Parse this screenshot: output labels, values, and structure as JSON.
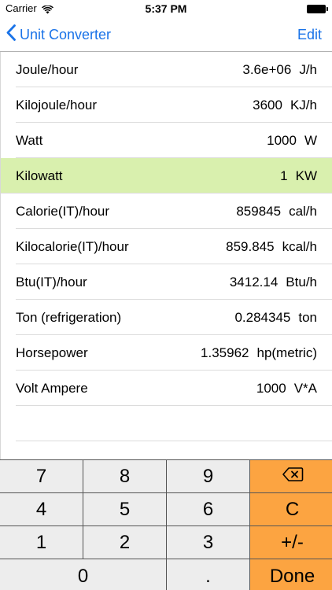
{
  "status_bar": {
    "carrier": "Carrier",
    "time": "5:37 PM"
  },
  "nav": {
    "back_label": "Unit Converter",
    "edit_label": "Edit"
  },
  "units": [
    {
      "name": "Joule/hour",
      "value": "3.6e+06",
      "symbol": "J/h"
    },
    {
      "name": "Kilojoule/hour",
      "value": "3600",
      "symbol": "KJ/h"
    },
    {
      "name": "Watt",
      "value": "1000",
      "symbol": "W"
    },
    {
      "name": "Kilowatt",
      "value": "1",
      "symbol": "KW",
      "selected": true
    },
    {
      "name": "Calorie(IT)/hour",
      "value": "859845",
      "symbol": "cal/h"
    },
    {
      "name": "Kilocalorie(IT)/hour",
      "value": "859.845",
      "symbol": "kcal/h"
    },
    {
      "name": "Btu(IT)/hour",
      "value": "3412.14",
      "symbol": "Btu/h"
    },
    {
      "name": "Ton (refrigeration)",
      "value": "0.284345",
      "symbol": "ton"
    },
    {
      "name": "Horsepower",
      "value": "1.35962",
      "symbol": "hp(metric)"
    },
    {
      "name": "Volt Ampere",
      "value": "1000",
      "symbol": "V*A"
    }
  ],
  "keypad": {
    "k7": "7",
    "k8": "8",
    "k9": "9",
    "k4": "4",
    "k5": "5",
    "k6": "6",
    "k1": "1",
    "k2": "2",
    "k3": "3",
    "k0": "0",
    "dot": ".",
    "clear": "C",
    "sign": "+/-",
    "done": "Done"
  },
  "colors": {
    "accent": "#1a73e8",
    "selected_row": "#d9f0ae",
    "action_key": "#fca441"
  }
}
